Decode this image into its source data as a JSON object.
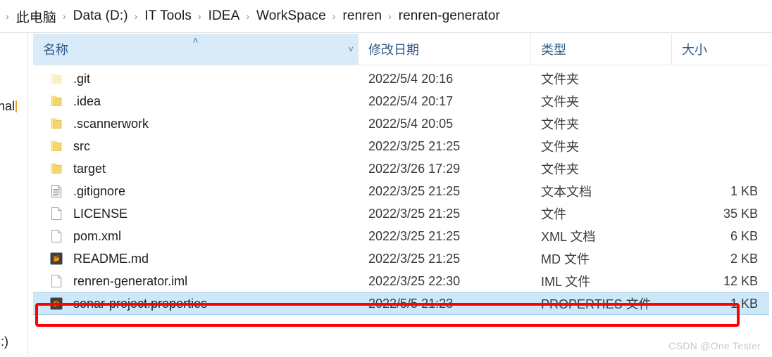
{
  "window": {
    "title": "renren-generator"
  },
  "breadcrumb": {
    "leading_chevron": "›",
    "separator": "›",
    "items": [
      {
        "label": "此电脑"
      },
      {
        "label": "Data (D:)"
      },
      {
        "label": "IT Tools"
      },
      {
        "label": "IDEA"
      },
      {
        "label": "WorkSpace"
      },
      {
        "label": "renren"
      },
      {
        "label": "renren-generator"
      }
    ]
  },
  "navpane": {
    "fragment_personal": "sonal",
    "fragment_cdrive": "(C:)"
  },
  "columns": {
    "name": {
      "label": "名称",
      "sorted": true,
      "sort_caret": "˄",
      "chevron": "˅"
    },
    "date": {
      "label": "修改日期"
    },
    "type": {
      "label": "类型"
    },
    "size": {
      "label": "大小"
    }
  },
  "rows": [
    {
      "name": ".git",
      "date": "2022/5/4 20:16",
      "type": "文件夹",
      "size": "",
      "icon": "folder-faded-icon",
      "selected": false
    },
    {
      "name": ".idea",
      "date": "2022/5/4 20:17",
      "type": "文件夹",
      "size": "",
      "icon": "folder-icon",
      "selected": false
    },
    {
      "name": ".scannerwork",
      "date": "2022/5/4 20:05",
      "type": "文件夹",
      "size": "",
      "icon": "folder-icon",
      "selected": false
    },
    {
      "name": "src",
      "date": "2022/3/25 21:25",
      "type": "文件夹",
      "size": "",
      "icon": "folder-icon",
      "selected": false
    },
    {
      "name": "target",
      "date": "2022/3/26 17:29",
      "type": "文件夹",
      "size": "",
      "icon": "folder-icon",
      "selected": false
    },
    {
      "name": ".gitignore",
      "date": "2022/3/25 21:25",
      "type": "文本文档",
      "size": "1 KB",
      "icon": "text-document-icon",
      "selected": false
    },
    {
      "name": "LICENSE",
      "date": "2022/3/25 21:25",
      "type": "文件",
      "size": "35 KB",
      "icon": "blank-file-icon",
      "selected": false
    },
    {
      "name": "pom.xml",
      "date": "2022/3/25 21:25",
      "type": "XML 文档",
      "size": "6 KB",
      "icon": "blank-file-icon",
      "selected": false
    },
    {
      "name": "README.md",
      "date": "2022/3/25 21:25",
      "type": "MD 文件",
      "size": "2 KB",
      "icon": "sublime-text-icon",
      "selected": false
    },
    {
      "name": "renren-generator.iml",
      "date": "2022/3/25 22:30",
      "type": "IML 文件",
      "size": "12 KB",
      "icon": "blank-file-icon",
      "selected": false
    },
    {
      "name": "sonar-project.properties",
      "date": "2022/5/5 21:23",
      "type": "PROPERTIES 文件",
      "size": "1 KB",
      "icon": "sublime-text-icon",
      "selected": true
    }
  ],
  "annotation": {
    "color": "#ff0000",
    "target_row": "sonar-project.properties"
  },
  "watermark": {
    "text": "CSDN @One Tester"
  },
  "colors": {
    "selection": "#cde8f9",
    "sorted_header": "#d9ebf9",
    "header_text": "#2e5a86",
    "folder": "#f6d66b",
    "folder_faded": "#fbeec0",
    "sublime_bg": "#3f3f3f",
    "sublime_s": "#ff9800",
    "annotation_red": "#ff0000",
    "watermark": "#c9c9c9"
  }
}
